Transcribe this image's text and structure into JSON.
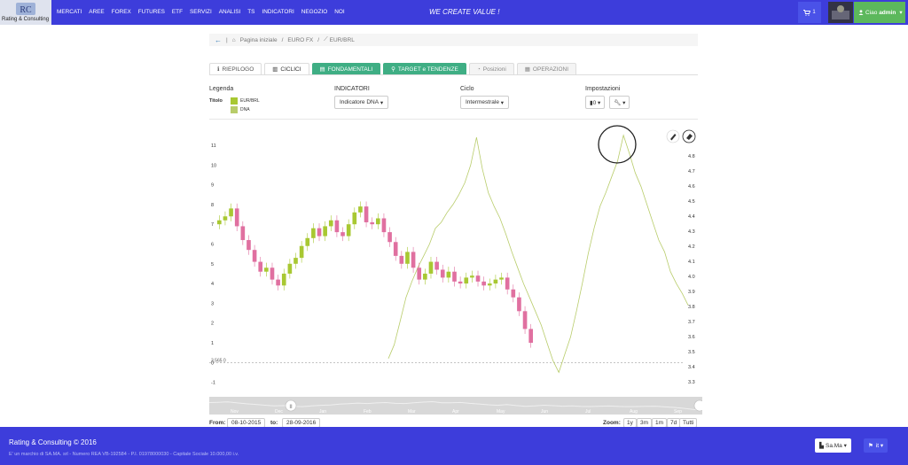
{
  "header": {
    "logo_text": "Rating & Consulting",
    "nav": [
      "MERCATI",
      "AREE",
      "FOREX",
      "FUTURES",
      "ETF",
      "SERVIZI",
      "ANALISI",
      "TS",
      "INDICATORI",
      "NEGOZIO",
      "NOI"
    ],
    "slogan": "WE CREATE VALUE !",
    "cart_count": "1",
    "user_greeting": "Ciao",
    "user_name": "admin"
  },
  "breadcrumb": [
    "Pagina iniziale",
    "EURO FX",
    "EUR/BRL"
  ],
  "tabs": [
    {
      "label": "RIEPILOGO",
      "style": "plain"
    },
    {
      "label": "CICLICI",
      "style": "active"
    },
    {
      "label": "FONDAMENTALI",
      "style": "green"
    },
    {
      "label": "TARGET e TENDENZE",
      "style": "green"
    },
    {
      "label": "Posizioni",
      "style": "gray"
    },
    {
      "label": "OPERAZIONI",
      "style": "gray"
    }
  ],
  "controls": {
    "legend_label": "Legenda",
    "titolo_label": "Titolo",
    "legend_items": [
      {
        "name": "EUR/BRL",
        "color": "#a8c832"
      },
      {
        "name": "DNA",
        "color": "#b8cc6a"
      }
    ],
    "indicatori_label": "INDICATORI",
    "indicatori_value": "Indicatore DNA",
    "ciclo_label": "Ciclo",
    "ciclo_value": "Intermestrale",
    "impostazioni_label": "Impostazioni"
  },
  "chart_data": {
    "type": "line",
    "left_axis_ticks": [
      "11",
      "10",
      "9",
      "8",
      "7",
      "6",
      "5",
      "4",
      "3",
      "2",
      "1",
      "0",
      "-1"
    ],
    "right_axis_ticks": [
      "4.8",
      "4.7",
      "4.6",
      "4.5",
      "4.4",
      "4.3",
      "4.2",
      "4.1",
      "4.0",
      "3.9",
      "3.8",
      "3.7",
      "3.6",
      "3.5",
      "3.4",
      "3.3"
    ],
    "baseline_label": "3.565 0",
    "navigator_months": [
      "Nov",
      "Dec",
      "Jan",
      "Feb",
      "Mar",
      "Apr",
      "May",
      "Jun",
      "Jul",
      "Aug",
      "Sep"
    ],
    "colors": {
      "up": "#a8c832",
      "down": "#e070a0",
      "dna": "#b8cc6a"
    },
    "eurbrl_close": [
      7.2,
      7.4,
      7.8,
      6.9,
      6.2,
      5.7,
      5.1,
      4.6,
      4.8,
      4.2,
      3.9,
      4.5,
      5.0,
      5.3,
      5.9,
      6.3,
      6.8,
      6.4,
      6.9,
      7.2,
      6.6,
      6.4,
      7.0,
      7.6,
      7.9,
      7.1,
      7.0,
      7.3,
      6.6,
      6.1,
      5.4,
      5.0,
      5.6,
      4.8,
      4.2,
      4.5,
      5.1,
      4.7,
      4.3,
      4.6,
      4.1,
      4.0,
      4.3,
      4.4,
      4.1,
      3.9,
      4.0,
      4.2,
      4.3,
      3.7,
      3.3,
      2.6,
      1.7,
      1.0
    ],
    "dna": [
      0.2,
      0.9,
      2.1,
      3.3,
      4.1,
      4.8,
      5.4,
      6.0,
      6.8,
      7.1,
      7.6,
      8.0,
      8.5,
      9.1,
      10.0,
      11.4,
      9.8,
      8.6,
      7.9,
      7.3,
      6.5,
      5.6,
      4.8,
      4.0,
      3.3,
      2.6,
      1.9,
      1.0,
      0.1,
      -0.5,
      0.4,
      1.3,
      2.6,
      4.0,
      5.5,
      6.8,
      7.9,
      8.6,
      9.4,
      10.2,
      11.5,
      10.6,
      9.6,
      8.9,
      8.0,
      7.1,
      6.2,
      5.6,
      4.6,
      4.0,
      3.5,
      2.9
    ]
  },
  "zoom": {
    "from_label": "From:",
    "from_value": "08-10-2015",
    "to_label": "to:",
    "to_value": "28-09-2016",
    "zoom_label": "Zoom:",
    "buttons": [
      "1y",
      "3m",
      "1m",
      "7d",
      "Tutti"
    ]
  },
  "footer": {
    "copyright": "Rating & Consulting © 2016",
    "legal": "E' un marchio di SA.MA. srl - Numero REA VB-192584 - P.I. 01978000030 - Capitale Sociale 10.000,00 i.v.",
    "profile_btn": "Sa.Ma",
    "lang_btn": "it"
  }
}
